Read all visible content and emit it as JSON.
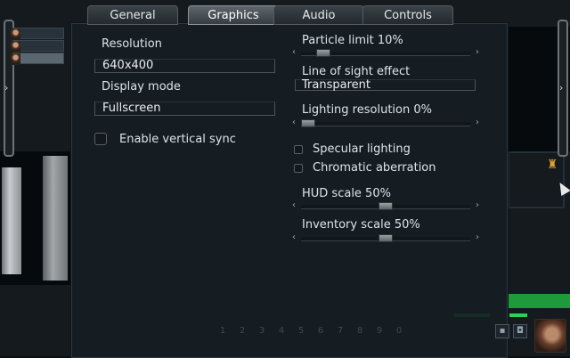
{
  "tabs": [
    {
      "label": "General",
      "active": false
    },
    {
      "label": "Graphics",
      "active": true
    },
    {
      "label": "Audio",
      "active": false
    },
    {
      "label": "Controls",
      "active": false
    }
  ],
  "left": {
    "resolution_label": "Resolution",
    "resolution_value": "640x400",
    "display_mode_label": "Display mode",
    "display_mode_value": "Fullscreen",
    "vsync_label": "Enable vertical sync",
    "vsync_checked": false
  },
  "right": {
    "particle_limit_label": "Particle limit 10%",
    "particle_limit_value": 0.1,
    "los_label": "Line of sight effect",
    "los_value": "Transparent",
    "lighting_res_label": "Lighting resolution 0%",
    "lighting_res_value": 0.0,
    "specular_label": "Specular lighting",
    "specular_checked": false,
    "chromatic_label": "Chromatic aberration",
    "chromatic_checked": false,
    "hud_scale_label": "HUD scale 50%",
    "hud_scale_value": 0.5,
    "inventory_scale_label": "Inventory scale 50%",
    "inventory_scale_value": 0.5
  },
  "icons": {
    "side_left": "chevron-left-icon",
    "side_right": "chevron-right-icon",
    "slider_left": "‹",
    "slider_right": "›"
  },
  "hotbar": [
    "1",
    "2",
    "3",
    "4",
    "5",
    "6",
    "7",
    "8",
    "9",
    "0"
  ],
  "colors": {
    "accent_green": "#2bd05a",
    "badge": "#e0a030"
  }
}
